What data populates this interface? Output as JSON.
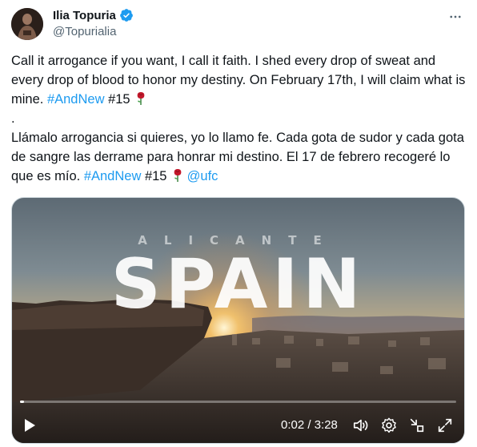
{
  "author": {
    "display_name": "Ilia Topuria",
    "handle": "@Topurialia"
  },
  "tweet": {
    "line_en_1": "Call it arrogance if you want, I call it faith. I shed every drop of sweat and every drop of blood to honor my destiny. On February 17th, I will claim what is mine. ",
    "hashtag_1": "#AndNew",
    "number_1": " #15 ",
    "separator": ".",
    "line_es_1": "Llámalo arrogancia si quieres, yo lo llamo fe. Cada gota de sudor y cada gota de sangre las derrame para honrar mi destino. El 17 de febrero recogeré lo que es mío. ",
    "hashtag_2": "#AndNew",
    "number_2": " #15 ",
    "mention": "@ufc"
  },
  "video": {
    "subtitle": "ALICANTE",
    "title": "SPAIN",
    "time_display": "0:02 / 3:28",
    "progress_fraction": 0.01
  },
  "icons": {
    "verified": "verified-badge-icon",
    "more": "more-icon",
    "rose": "rose-icon",
    "play": "play-icon",
    "volume": "volume-icon",
    "settings": "settings-icon",
    "minimize": "minimize-icon",
    "fullscreen": "fullscreen-icon"
  },
  "colors": {
    "link": "#1d9bf0",
    "verified": "#1d9bf0",
    "secondary_text": "#536471"
  }
}
